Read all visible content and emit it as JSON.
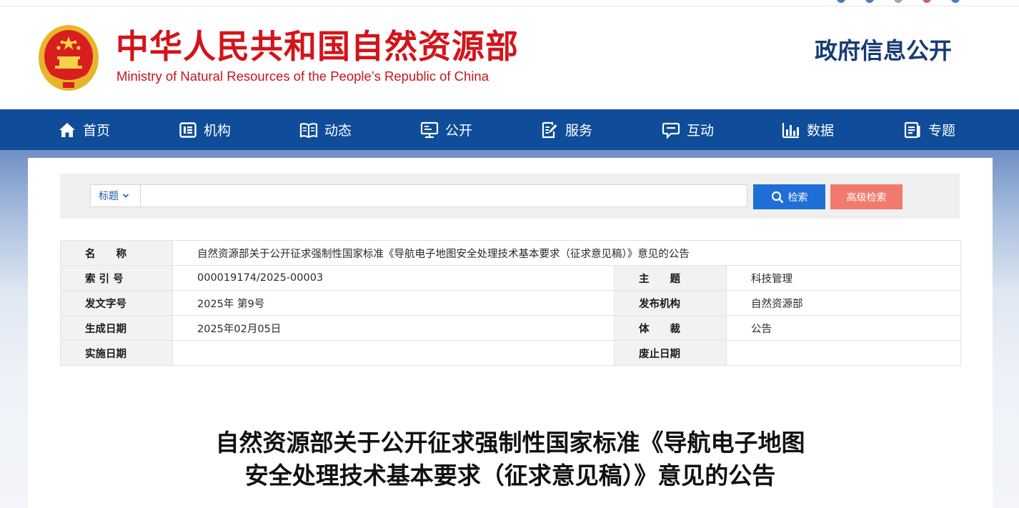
{
  "header": {
    "site_title": "中华人民共和国自然资源部",
    "site_subtitle": "Ministry of Natural Resources of the People’s Republic of China",
    "section_title": "政府信息公开",
    "emblem_icon": "national-emblem-icon"
  },
  "nav": {
    "items": [
      {
        "label": "首页",
        "icon": "home-icon"
      },
      {
        "label": "机构",
        "icon": "organization-icon"
      },
      {
        "label": "动态",
        "icon": "news-book-icon"
      },
      {
        "label": "公开",
        "icon": "monitor-icon"
      },
      {
        "label": "服务",
        "icon": "service-document-icon"
      },
      {
        "label": "互动",
        "icon": "chat-bubble-icon"
      },
      {
        "label": "数据",
        "icon": "bar-chart-icon"
      },
      {
        "label": "专题",
        "icon": "topic-icon"
      }
    ]
  },
  "search": {
    "field_select": "标题",
    "input_value": "",
    "search_label": "检索",
    "advanced_label": "高级检索"
  },
  "meta": {
    "name_label": "名　　称",
    "name_value": "自然资源部关于公开征求强制性国家标准《导航电子地图安全处理技术基本要求（征求意见稿）》意见的公告",
    "index_label": "索 引 号",
    "index_value": "000019174/2025-00003",
    "subject_label": "主　　题",
    "subject_value": "科技管理",
    "doc_no_label": "发文字号",
    "doc_no_value": "2025年 第9号",
    "publisher_label": "发布机构",
    "publisher_value": "自然资源部",
    "created_label": "生成日期",
    "created_value": "2025年02月05日",
    "genre_label": "体　　裁",
    "genre_value": "公告",
    "effective_label": "实施日期",
    "effective_value": "",
    "expiry_label": "废止日期",
    "expiry_value": ""
  },
  "article": {
    "title_line1": "自然资源部关于公开征求强制性国家标准《导航电子地图",
    "title_line2": "安全处理技术基本要求（征求意见稿）》意见的公告"
  },
  "colors": {
    "brand_red": "#d3141b",
    "nav_blue": "#0f4c99",
    "section_title_blue": "#173b75",
    "search_button": "#1f6fd6",
    "advanced_button": "#f17a6d"
  }
}
